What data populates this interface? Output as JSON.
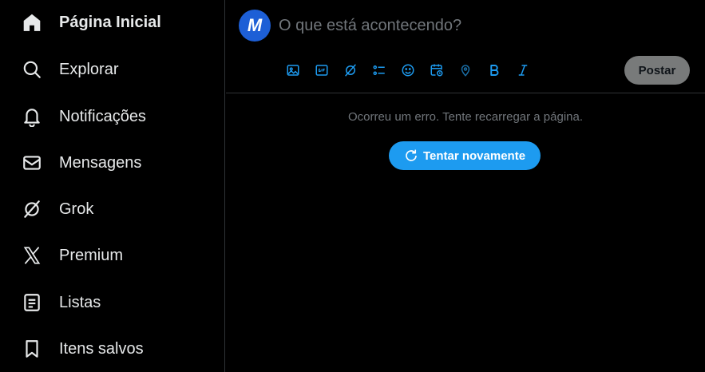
{
  "sidebar": {
    "items": [
      {
        "label": "Página Inicial",
        "icon": "home-icon"
      },
      {
        "label": "Explorar",
        "icon": "search-icon"
      },
      {
        "label": "Notificações",
        "icon": "bell-icon"
      },
      {
        "label": "Mensagens",
        "icon": "envelope-icon"
      },
      {
        "label": "Grok",
        "icon": "grok-icon"
      },
      {
        "label": "Premium",
        "icon": "x-logo-icon"
      },
      {
        "label": "Listas",
        "icon": "list-icon"
      },
      {
        "label": "Itens salvos",
        "icon": "bookmark-icon"
      }
    ]
  },
  "composer": {
    "avatar_letter": "M",
    "placeholder": "O que está acontecendo?",
    "post_label": "Postar",
    "toolbar_icons": [
      "image-icon",
      "gif-icon",
      "grok-icon",
      "poll-icon",
      "emoji-icon",
      "schedule-icon",
      "location-icon",
      "bold-icon",
      "italic-icon"
    ]
  },
  "feed": {
    "error_message": "Ocorreu um erro. Tente recarregar a página.",
    "retry_label": "Tentar novamente"
  },
  "colors": {
    "accent": "#1d9bf0",
    "background": "#000000",
    "border": "#2f3336",
    "muted_text": "#71767b",
    "avatar": "#1d5fd6"
  }
}
